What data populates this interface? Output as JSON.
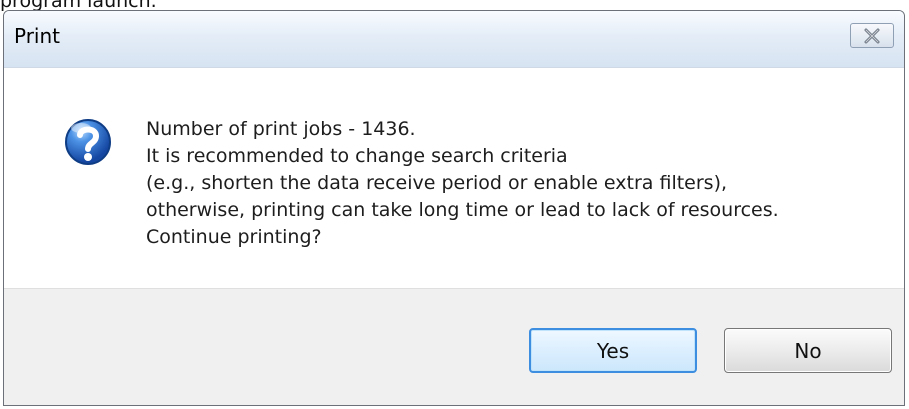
{
  "top_fragment": "program launch.",
  "dialog": {
    "title": "Print",
    "close_icon": "close-icon",
    "question_icon": "question-icon",
    "message_lines": [
      "Number of print jobs - 1436.",
      "It is recommended to change search criteria",
      "(e.g., shorten the data receive period or enable extra filters),",
      "otherwise, printing can take long time or lead to lack of resources.",
      "Continue printing?"
    ],
    "buttons": {
      "yes": "Yes",
      "no": "No"
    },
    "colors": {
      "accent_blue": "#3d8ee0",
      "titlebar": "#dfe9f5",
      "footer": "#f0f0f0",
      "icon_blue": "#2563b8"
    }
  }
}
